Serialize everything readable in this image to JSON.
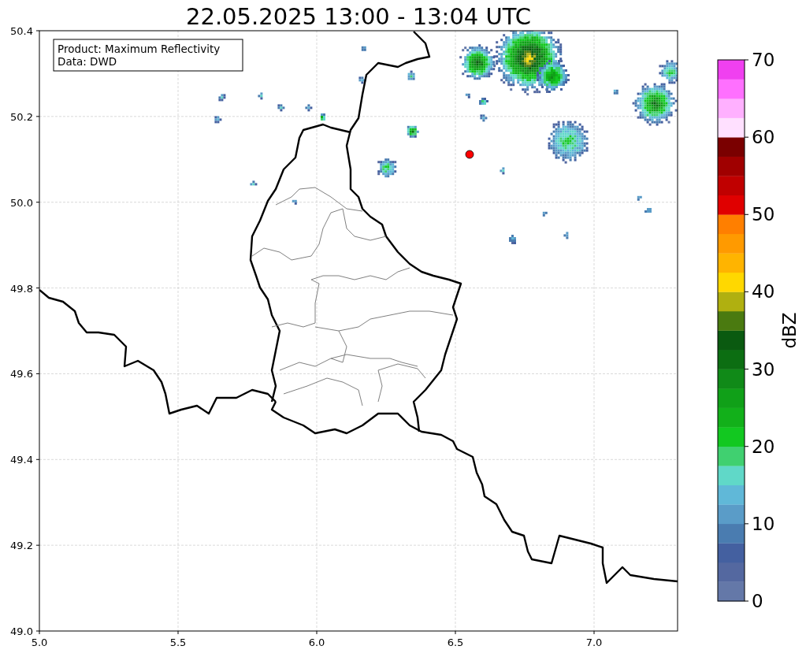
{
  "title": "22.05.2025 13:00 - 13:04 UTC",
  "info_box": {
    "lines": [
      "Product: Maximum Reflectivity",
      "Data: DWD"
    ]
  },
  "map": {
    "x_ticks": [
      "5.0",
      "5.5",
      "6.0",
      "6.5",
      "7.0"
    ],
    "y_ticks": [
      "50.4",
      "50.2",
      "50.0",
      "49.8",
      "49.6",
      "49.4",
      "49.2",
      "49.0"
    ]
  },
  "colorbar": {
    "label": "dBZ",
    "ticks": [
      "70",
      "60",
      "50",
      "40",
      "30",
      "20",
      "10",
      "0"
    ],
    "bands": [
      {
        "color": "#6478a8"
      },
      {
        "color": "#5468a0"
      },
      {
        "color": "#4460a0"
      },
      {
        "color": "#4a7cb0"
      },
      {
        "color": "#5a9cc8"
      },
      {
        "color": "#60b8d8"
      },
      {
        "color": "#60d8c8"
      },
      {
        "color": "#40d070"
      },
      {
        "color": "#12c820"
      },
      {
        "color": "#12b01a"
      },
      {
        "color": "#10a018"
      },
      {
        "color": "#108a18"
      },
      {
        "color": "#0c6e12"
      },
      {
        "color": "#0a5a10"
      },
      {
        "color": "#4a7a10"
      },
      {
        "color": "#b0b010"
      },
      {
        "color": "#ffd800"
      },
      {
        "color": "#ffb400"
      },
      {
        "color": "#ff9a00"
      },
      {
        "color": "#ff7f00"
      },
      {
        "color": "#e00000"
      },
      {
        "color": "#c00000"
      },
      {
        "color": "#a00000"
      },
      {
        "color": "#7a0000"
      },
      {
        "color": "#ffe0ff"
      },
      {
        "color": "#ffb0ff"
      },
      {
        "color": "#ff70ff"
      },
      {
        "color": "#f040f0"
      }
    ]
  }
}
